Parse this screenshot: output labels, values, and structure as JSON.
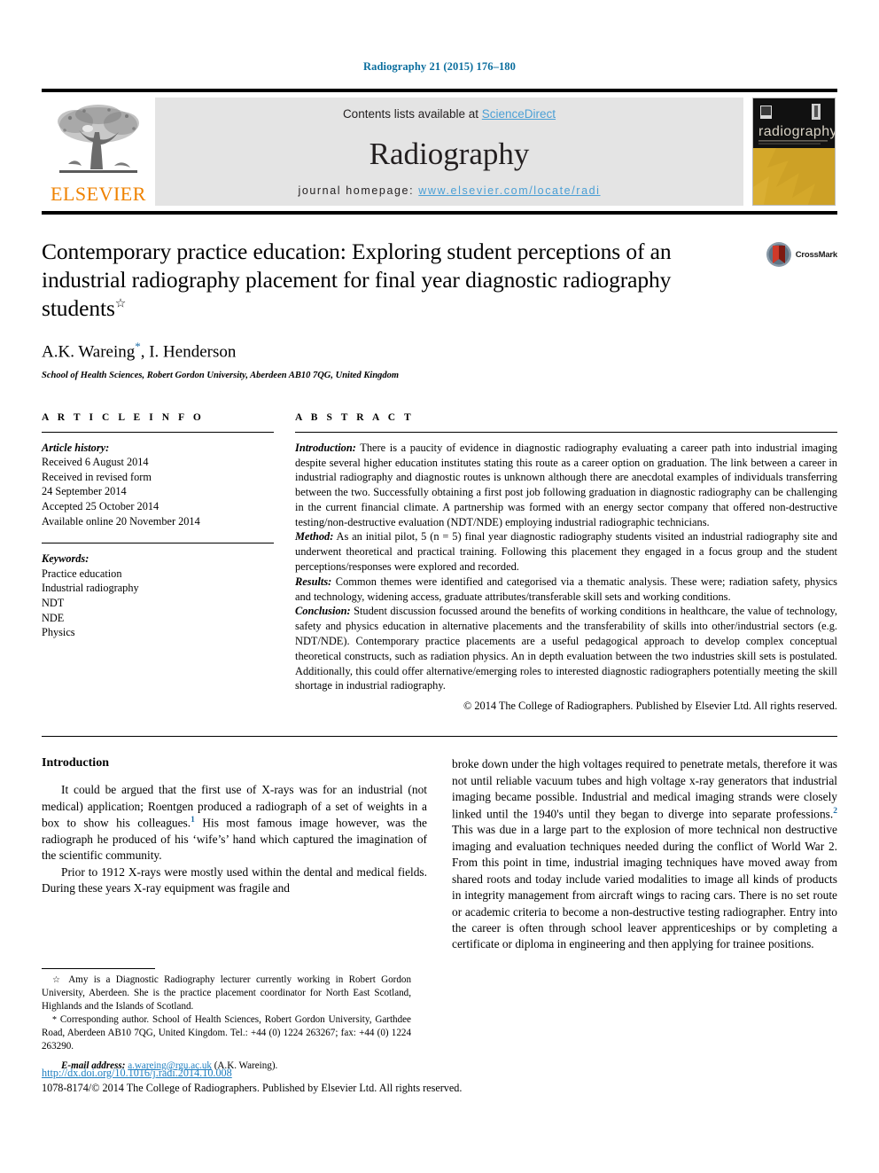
{
  "citation": "Radiography 21 (2015) 176–180",
  "masthead": {
    "publisher_name": "ELSEVIER",
    "contents_text": "Contents lists available at ",
    "contents_link": "ScienceDirect",
    "journal_name": "Radiography",
    "homepage_label": "journal homepage: ",
    "homepage_link": "www.elsevier.com/locate/radi",
    "cover_title": "radiography",
    "cover_subtitle": "OFFICIAL JOURNAL OF THE COLLEGE OF RADIOGRAPHERS"
  },
  "article": {
    "title": "Contemporary practice education: Exploring student perceptions of an industrial radiography placement for final year diagnostic radiography students",
    "title_marker": "☆",
    "authors": "A.K. Wareing",
    "authors_marker": "*",
    "authors_rest": ", I. Henderson",
    "affiliation": "School of Health Sciences, Robert Gordon University, Aberdeen AB10 7QG, United Kingdom",
    "crossmark_label": "CrossMark"
  },
  "article_info": {
    "heading": "A R T I C L E   I N F O",
    "history_label": "Article history:",
    "history": [
      "Received 6 August 2014",
      "Received in revised form",
      "24 September 2014",
      "Accepted 25 October 2014",
      "Available online 20 November 2014"
    ],
    "keywords_label": "Keywords:",
    "keywords": [
      "Practice education",
      "Industrial radiography",
      "NDT",
      "NDE",
      "Physics"
    ]
  },
  "abstract": {
    "heading": "A B S T R A C T",
    "introduction_label": "Introduction:",
    "introduction_text": " There is a paucity of evidence in diagnostic radiography evaluating a career path into industrial imaging despite several higher education institutes stating this route as a career option on graduation. The link between a career in industrial radiography and diagnostic routes is unknown although there are anecdotal examples of individuals transferring between the two. Successfully obtaining a first post job following graduation in diagnostic radiography can be challenging in the current financial climate. A partnership was formed with an energy sector company that offered non-destructive testing/non-destructive evaluation (NDT/NDE) employing industrial radiographic technicians.",
    "method_label": "Method:",
    "method_text": " As an initial pilot, 5 (n = 5) final year diagnostic radiography students visited an industrial radiography site and underwent theoretical and practical training. Following this placement they engaged in a focus group and the student perceptions/responses were explored and recorded.",
    "results_label": "Results:",
    "results_text": " Common themes were identified and categorised via a thematic analysis. These were; radiation safety, physics and technology, widening access, graduate attributes/transferable skill sets and working conditions.",
    "conclusion_label": "Conclusion:",
    "conclusion_text": " Student discussion focussed around the benefits of working conditions in healthcare, the value of technology, safety and physics education in alternative placements and the transferability of skills into other/industrial sectors (e.g. NDT/NDE). Contemporary practice placements are a useful pedagogical approach to develop complex conceptual theoretical constructs, such as radiation physics. An in depth evaluation between the two industries skill sets is postulated. Additionally, this could offer alternative/emerging roles to interested diagnostic radiographers potentially meeting the skill shortage in industrial radiography.",
    "copyright": "© 2014 The College of Radiographers. Published by Elsevier Ltd. All rights reserved."
  },
  "body": {
    "heading": "Introduction",
    "left_para_1_a": "It could be argued that the first use of X-rays was for an industrial (not medical) application; Roentgen produced a radiograph of a set of weights in a box to show his colleagues.",
    "left_para_1_ref": "1",
    "left_para_1_b": " His most famous image however, was the radiograph he produced of his ‘wife’s’ hand which captured the imagination of the scientific community.",
    "left_para_2": "Prior to 1912 X-rays were mostly used within the dental and medical fields. During these years X-ray equipment was fragile and",
    "right_para_1_a": "broke down under the high voltages required to penetrate metals, therefore it was not until reliable vacuum tubes and high voltage x-ray generators that industrial imaging became possible. Industrial and medical imaging strands were closely linked until the 1940's until they began to diverge into separate professions.",
    "right_para_1_ref": "2",
    "right_para_1_b": " This was due in a large part to the explosion of more technical non destructive imaging and evaluation techniques needed during the conflict of World War 2. From this point in time, industrial imaging techniques have moved away from shared roots and today include varied modalities to image all kinds of products in integrity management from aircraft wings to racing cars. There is no set route or academic criteria to become a non-destructive testing radiographer. Entry into the career is often through school leaver apprenticeships or by completing a certificate or diploma in engineering and then applying for trainee positions."
  },
  "footnotes": {
    "note_star_mark": "☆",
    "note_star_text": " Amy is a Diagnostic Radiography lecturer currently working in Robert Gordon University, Aberdeen. She is the practice placement coordinator for North East Scotland, Highlands and the Islands of Scotland.",
    "note_corr_mark": "*",
    "note_corr_text": " Corresponding author. School of Health Sciences, Robert Gordon University, Garthdee Road, Aberdeen AB10 7QG, United Kingdom. Tel.: +44 (0) 1224 263267; fax: +44 (0) 1224 263290.",
    "email_label": "E-mail address:",
    "email_address": "a.wareing@rgu.ac.uk",
    "email_suffix": " (A.K. Wareing)."
  },
  "footer": {
    "doi": "http://dx.doi.org/10.1016/j.radi.2014.10.008",
    "issn_copyright": "1078-8174/© 2014 The College of Radiographers. Published by Elsevier Ltd. All rights reserved."
  },
  "colors": {
    "citation_blue": "#0b6e9e",
    "link_blue": "#4a9fd5",
    "elsevier_orange": "#ef8200",
    "band_grey": "#e4e4e4",
    "cover_gold": "#d4a82a",
    "ref_blue": "#1f6fa8"
  }
}
